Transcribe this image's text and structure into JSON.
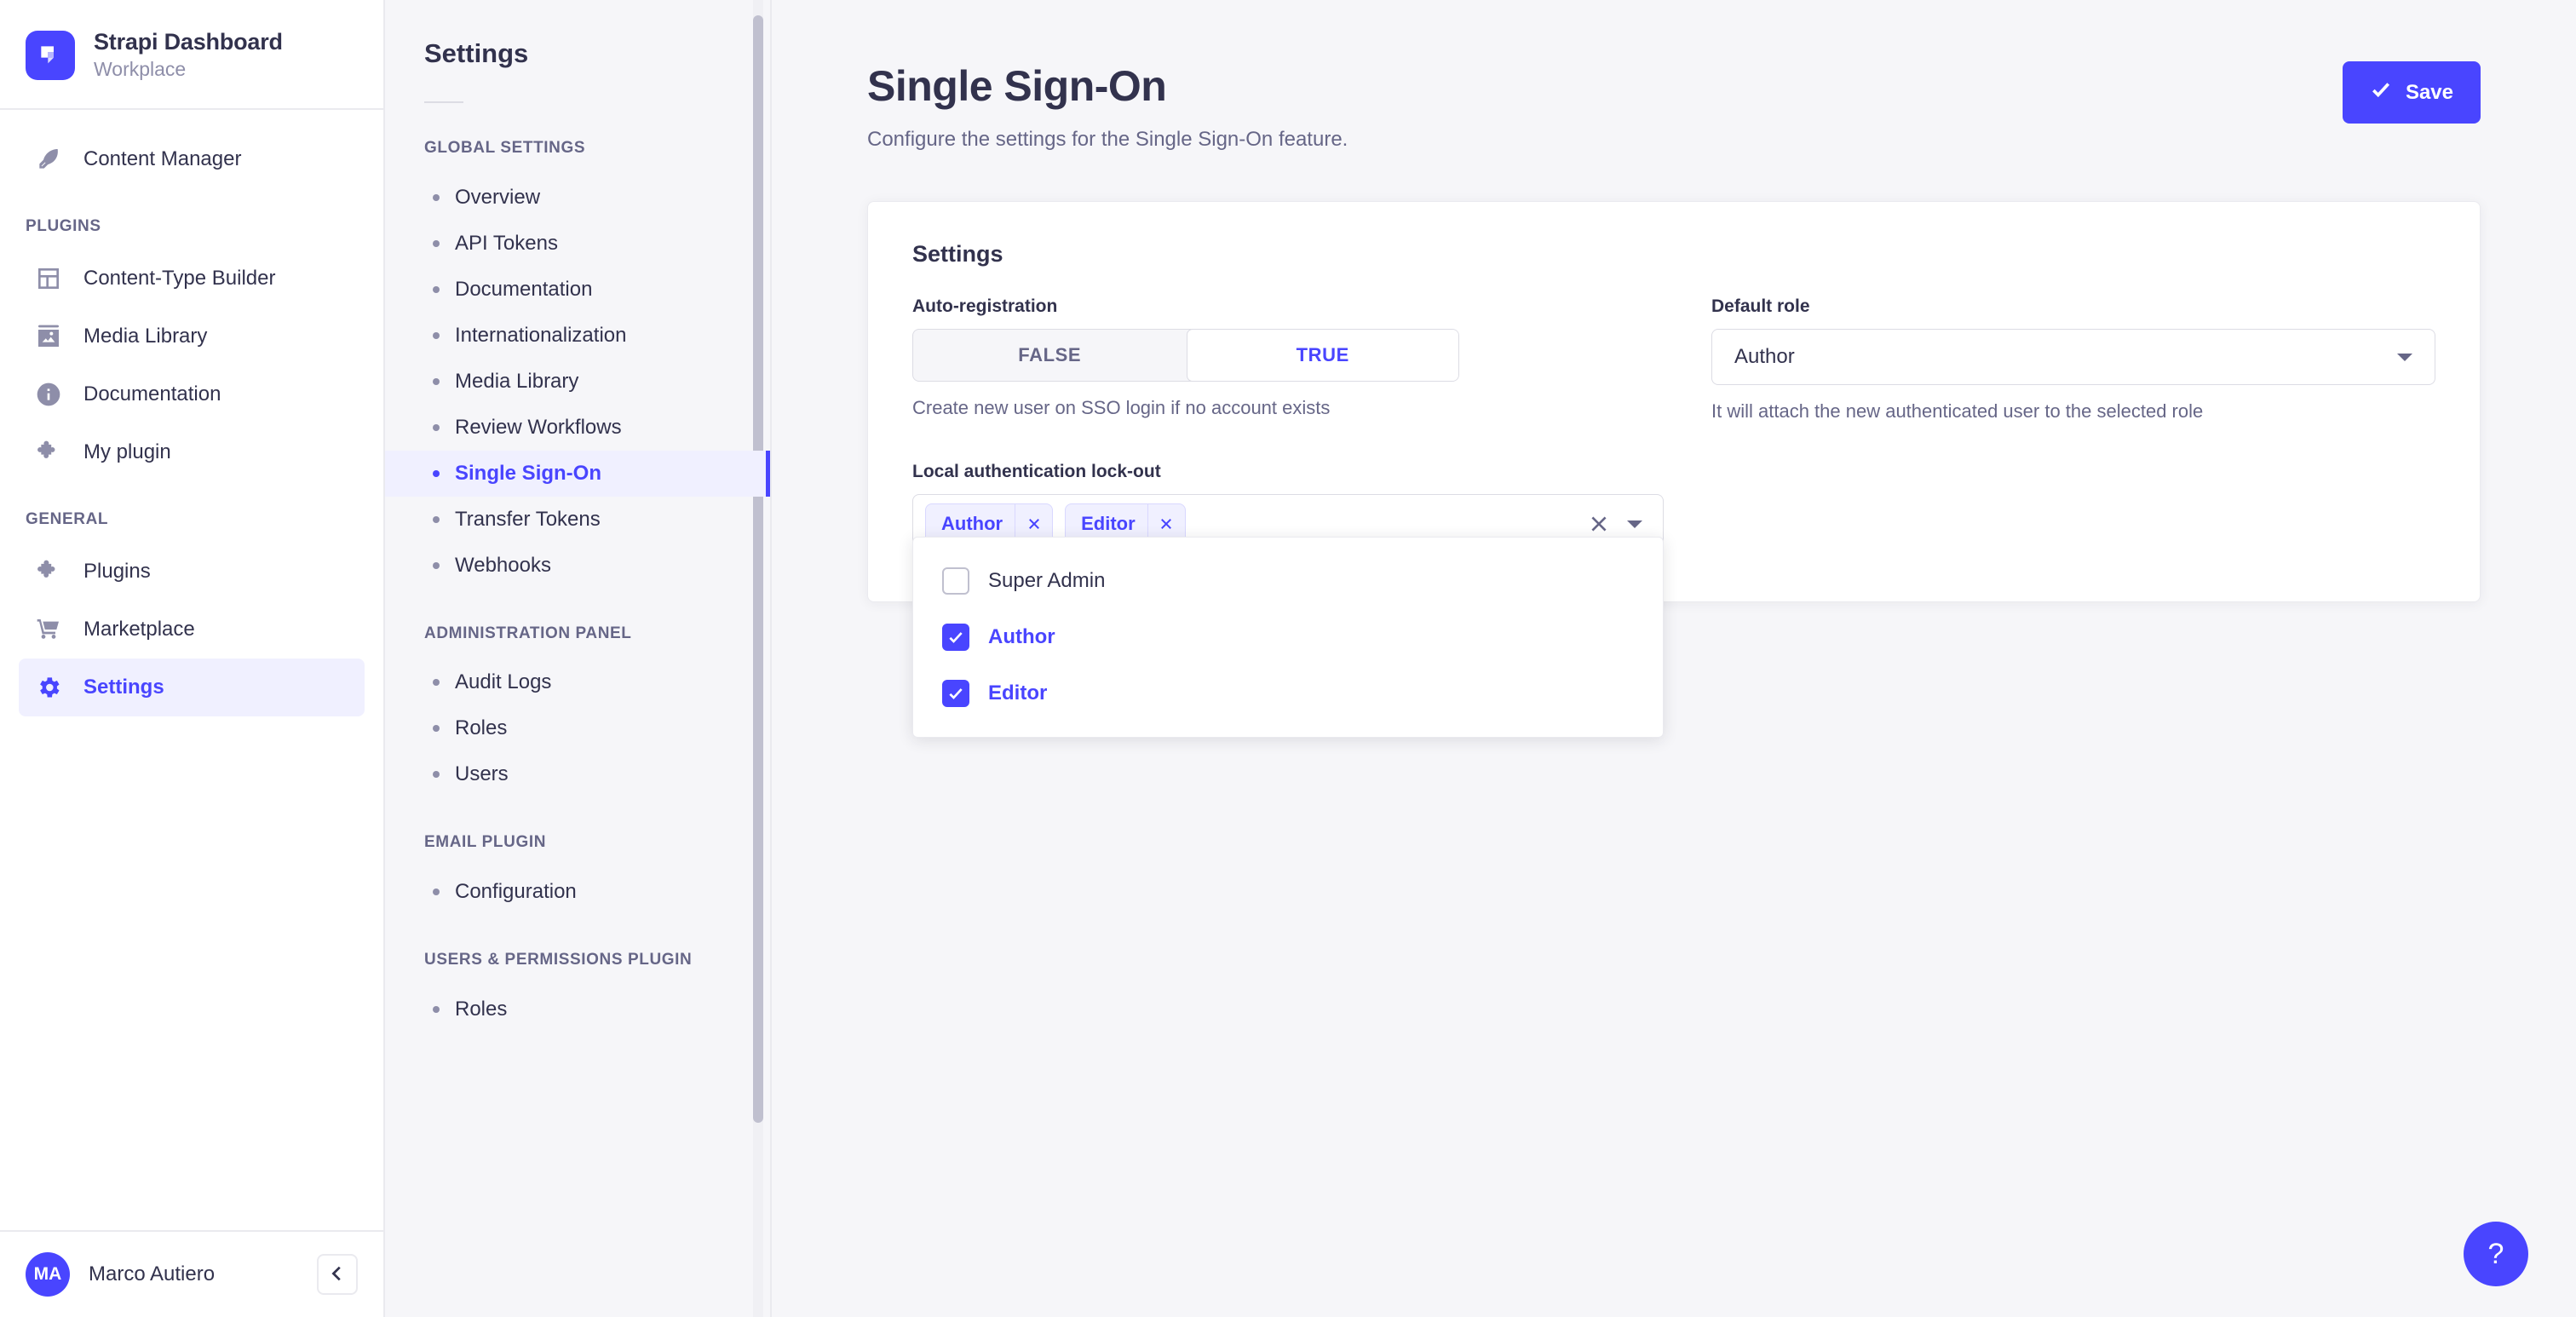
{
  "brand": {
    "title": "Strapi Dashboard",
    "subtitle": "Workplace",
    "logo_icon": "strapi-logo-icon",
    "logo_color": "#4945ff"
  },
  "sidebar": {
    "top_items": [
      {
        "label": "Content Manager",
        "icon": "feather-icon"
      }
    ],
    "sections": [
      {
        "label": "PLUGINS",
        "items": [
          {
            "label": "Content-Type Builder",
            "icon": "layout-icon"
          },
          {
            "label": "Media Library",
            "icon": "image-icon"
          },
          {
            "label": "Documentation",
            "icon": "info-icon"
          },
          {
            "label": "My plugin",
            "icon": "puzzle-icon"
          }
        ]
      },
      {
        "label": "GENERAL",
        "items": [
          {
            "label": "Plugins",
            "icon": "puzzle-icon"
          },
          {
            "label": "Marketplace",
            "icon": "cart-icon"
          },
          {
            "label": "Settings",
            "icon": "gear-icon",
            "active": true
          }
        ]
      }
    ],
    "footer": {
      "avatar_initials": "MA",
      "user_name": "Marco Autiero",
      "collapse_icon": "chevron-left-icon"
    }
  },
  "settings_nav": {
    "title": "Settings",
    "sections": [
      {
        "label": "GLOBAL SETTINGS",
        "items": [
          {
            "label": "Overview"
          },
          {
            "label": "API Tokens"
          },
          {
            "label": "Documentation"
          },
          {
            "label": "Internationalization"
          },
          {
            "label": "Media Library"
          },
          {
            "label": "Review Workflows"
          },
          {
            "label": "Single Sign-On",
            "active": true
          },
          {
            "label": "Transfer Tokens"
          },
          {
            "label": "Webhooks"
          }
        ]
      },
      {
        "label": "ADMINISTRATION PANEL",
        "items": [
          {
            "label": "Audit Logs"
          },
          {
            "label": "Roles"
          },
          {
            "label": "Users"
          }
        ]
      },
      {
        "label": "EMAIL PLUGIN",
        "items": [
          {
            "label": "Configuration"
          }
        ]
      },
      {
        "label": "USERS & PERMISSIONS PLUGIN",
        "items": [
          {
            "label": "Roles"
          }
        ]
      }
    ]
  },
  "page": {
    "title": "Single Sign-On",
    "subtitle": "Configure the settings for the Single Sign-On feature.",
    "save_label": "Save",
    "save_icon": "check-icon",
    "accent_color": "#4945ff"
  },
  "card": {
    "title": "Settings",
    "auto_registration": {
      "label": "Auto-registration",
      "options": [
        "FALSE",
        "TRUE"
      ],
      "selected": "TRUE",
      "hint": "Create new user on SSO login if no account exists"
    },
    "default_role": {
      "label": "Default role",
      "value": "Author",
      "hint": "It will attach the new authenticated user to the selected role",
      "caret_icon": "chevron-down-icon"
    },
    "lockout": {
      "label": "Local authentication lock-out",
      "chips": [
        "Author",
        "Editor"
      ],
      "chip_remove_icon": "close-icon",
      "clear_icon": "clear-x-icon",
      "caret_icon": "chevron-down-icon",
      "options": [
        {
          "label": "Super Admin",
          "checked": false
        },
        {
          "label": "Author",
          "checked": true
        },
        {
          "label": "Editor",
          "checked": true
        }
      ]
    }
  },
  "help": {
    "label": "?",
    "icon": "question-mark-icon"
  }
}
